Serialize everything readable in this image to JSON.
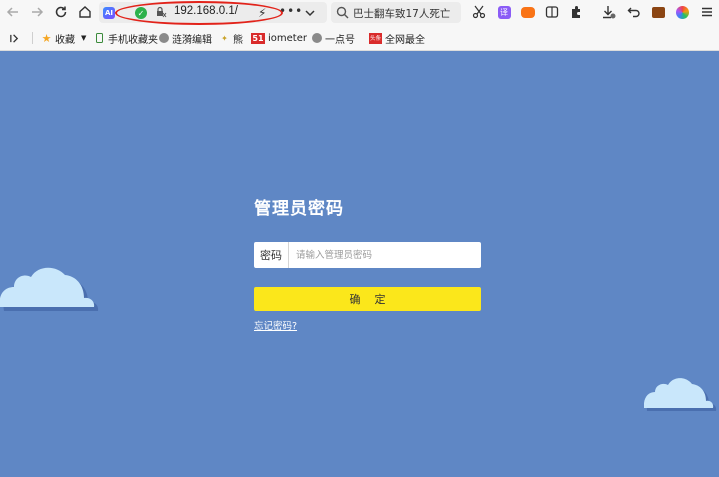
{
  "browser": {
    "url": "192.168.0.1/",
    "search_text": "巴士翻车致17人死亡",
    "url_more": "•••",
    "ai_badge": "AI",
    "shield_check": "✓"
  },
  "bookmarks": [
    {
      "label": "收藏",
      "icon": "star-icon"
    },
    {
      "label": "手机收藏夹",
      "icon": "phone-icon"
    },
    {
      "label": "涟漪编辑",
      "icon": "globe-icon"
    },
    {
      "label": "熊",
      "icon": "leaf-icon"
    },
    {
      "label": "iometer",
      "icon": "51-logo-icon",
      "badge": "51"
    },
    {
      "label": "一点号",
      "icon": "globe-icon"
    },
    {
      "label": "全网最全",
      "icon": "badge-icon",
      "badge": "头条"
    }
  ],
  "login": {
    "title": "管理员密码",
    "password_label": "密码",
    "password_placeholder": "请输入管理员密码",
    "confirm_label": "确定",
    "forgot_label": "忘记密码?"
  },
  "colors": {
    "background": "#5f87c5",
    "confirm_button": "#fbe71b",
    "cloud": "#c9e7fb",
    "highlight_ring": "#e2231a"
  }
}
